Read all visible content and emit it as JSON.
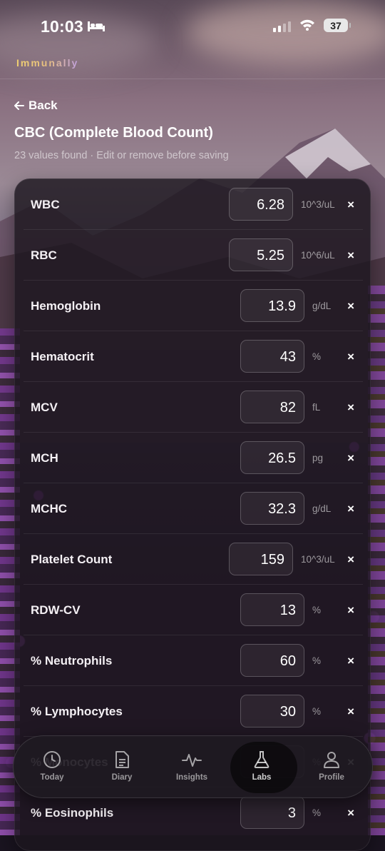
{
  "status_bar": {
    "time": "10:03",
    "battery": "37"
  },
  "brand": "Immunally",
  "back_label": "Back",
  "title": "CBC (Complete Blood Count)",
  "subtitle": "23 values found · Edit or remove before saving",
  "remove_glyph": "×",
  "rows": [
    {
      "label": "WBC",
      "value": "6.28",
      "unit": "10^3/uL"
    },
    {
      "label": "RBC",
      "value": "5.25",
      "unit": "10^6/uL"
    },
    {
      "label": "Hemoglobin",
      "value": "13.9",
      "unit": "g/dL"
    },
    {
      "label": "Hematocrit",
      "value": "43",
      "unit": "%"
    },
    {
      "label": "MCV",
      "value": "82",
      "unit": "fL"
    },
    {
      "label": "MCH",
      "value": "26.5",
      "unit": "pg"
    },
    {
      "label": "MCHC",
      "value": "32.3",
      "unit": "g/dL"
    },
    {
      "label": "Platelet Count",
      "value": "159",
      "unit": "10^3/uL"
    },
    {
      "label": "RDW-CV",
      "value": "13",
      "unit": "%"
    },
    {
      "label": "% Neutrophils",
      "value": "60",
      "unit": "%"
    },
    {
      "label": "% Lymphocytes",
      "value": "30",
      "unit": "%"
    },
    {
      "label": "% Monocytes",
      "value": "",
      "unit": "%"
    },
    {
      "label": "% Eosinophils",
      "value": "3",
      "unit": "%"
    }
  ],
  "tabs": [
    {
      "label": "Today",
      "icon": "clock-icon",
      "active": false
    },
    {
      "label": "Diary",
      "icon": "document-icon",
      "active": false
    },
    {
      "label": "Insights",
      "icon": "pulse-icon",
      "active": false
    },
    {
      "label": "Labs",
      "icon": "flask-icon",
      "active": true
    },
    {
      "label": "Profile",
      "icon": "person-icon",
      "active": false
    }
  ]
}
